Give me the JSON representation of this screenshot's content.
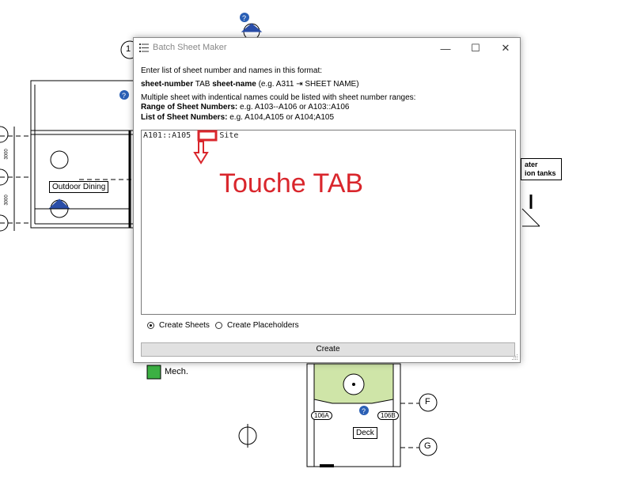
{
  "window": {
    "title": "Batch Sheet Maker",
    "minimize": "—",
    "maximize": "☐",
    "close": "✕"
  },
  "instructions": {
    "line1": "Enter list of sheet number and names in this format:",
    "line2_bold1": "sheet-number",
    "line2_mid": " TAB ",
    "line2_bold2": "sheet-name",
    "line2_rest": " (e.g. A311  ⇥  SHEET NAME)",
    "line3": "Multiple sheet with indentical names could be listed with sheet number ranges:",
    "line4_bold": "Range of Sheet Numbers:",
    "line4_rest": " e.g. A103--A106 or A103::A106",
    "line5_bold": "List of Sheet Numbers:",
    "line5_rest": " e.g. A104,A105 or A104;A105"
  },
  "editor": {
    "value_prefix": "A101::A105",
    "value_suffix": "Site"
  },
  "options": {
    "create_sheets": "Create Sheets",
    "create_placeholders": "Create Placeholders",
    "selected": "create_sheets"
  },
  "create_button": "Create",
  "annotation": {
    "text": "Touche TAB",
    "color": "#d9262c"
  },
  "background": {
    "outdoor_dining": "Outdoor Dining",
    "mech": "Mech.",
    "water_line1": "ater",
    "water_line2": "ion tanks",
    "label_106a": "106A",
    "label_106b": "106B",
    "deck": "Deck",
    "grid_f": "F",
    "grid_g": "G",
    "grid_1": "1",
    "dim1": "3000",
    "dim2": "3000",
    "mech_color": "#3cb043",
    "planter_color": "#cfe5a8"
  }
}
